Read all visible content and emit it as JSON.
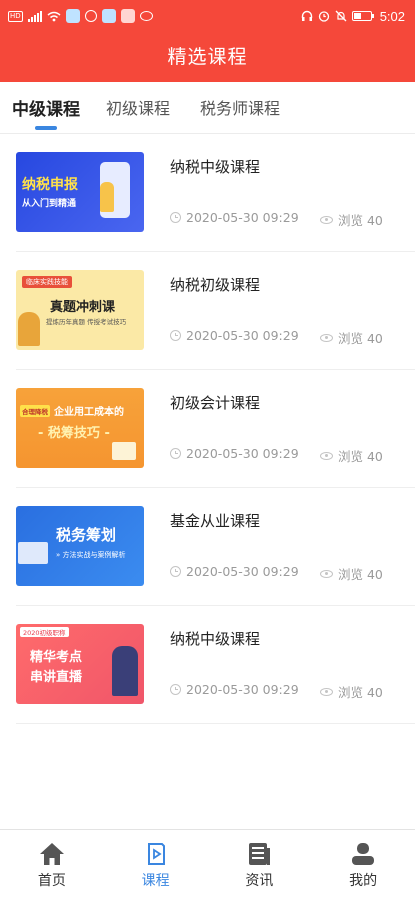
{
  "status_bar": {
    "sim_label": "HD",
    "time": "5:02"
  },
  "header": {
    "title": "精选课程",
    "bg_color": "#f5483a"
  },
  "tabs": [
    {
      "label": "中级课程",
      "active": true
    },
    {
      "label": "初级课程",
      "active": false
    },
    {
      "label": "税务师课程",
      "active": false
    }
  ],
  "courses": [
    {
      "title": "纳税中级课程",
      "date": "2020-05-30 09:29",
      "views": "浏览 40",
      "thumb": {
        "line1": "纳税申报",
        "line2": "从入门到精通",
        "bg": "#3557e8",
        "accent": "#ffd640"
      }
    },
    {
      "title": "纳税初级课程",
      "date": "2020-05-30 09:29",
      "views": "浏览 40",
      "thumb": {
        "badge": "临床实践技能",
        "line1": "真题冲刺课",
        "line2": "提炼历年真题 传授考试技巧",
        "bg": "#fbe9a6",
        "accent": "#e8503a"
      }
    },
    {
      "title": "初级会计课程",
      "date": "2020-05-30 09:29",
      "views": "浏览 40",
      "thumb": {
        "badge": "合理降税",
        "line1": "企业用工成本的",
        "line2": "- 税筹技巧 -",
        "bg": "#f7a23a",
        "accent": "#fff2b0"
      }
    },
    {
      "title": "基金从业课程",
      "date": "2020-05-30 09:29",
      "views": "浏览 40",
      "thumb": {
        "line1": "税务筹划",
        "line2": "» 方法实战与案例解析",
        "bg": "#2f7ae6",
        "accent": "#ffffff"
      }
    },
    {
      "title": "纳税中级课程",
      "date": "2020-05-30 09:29",
      "views": "浏览 40",
      "thumb": {
        "badge": "2020初级职称",
        "line1": "精华考点",
        "line2": "串讲直播",
        "bg": "#f0566a",
        "accent": "#ffffff"
      }
    }
  ],
  "bottom_nav": [
    {
      "label": "首页",
      "icon": "home-icon",
      "active": false
    },
    {
      "label": "课程",
      "icon": "course-icon",
      "active": true
    },
    {
      "label": "资讯",
      "icon": "news-icon",
      "active": false
    },
    {
      "label": "我的",
      "icon": "user-icon",
      "active": false
    }
  ],
  "accent_color": "#3a86e0"
}
